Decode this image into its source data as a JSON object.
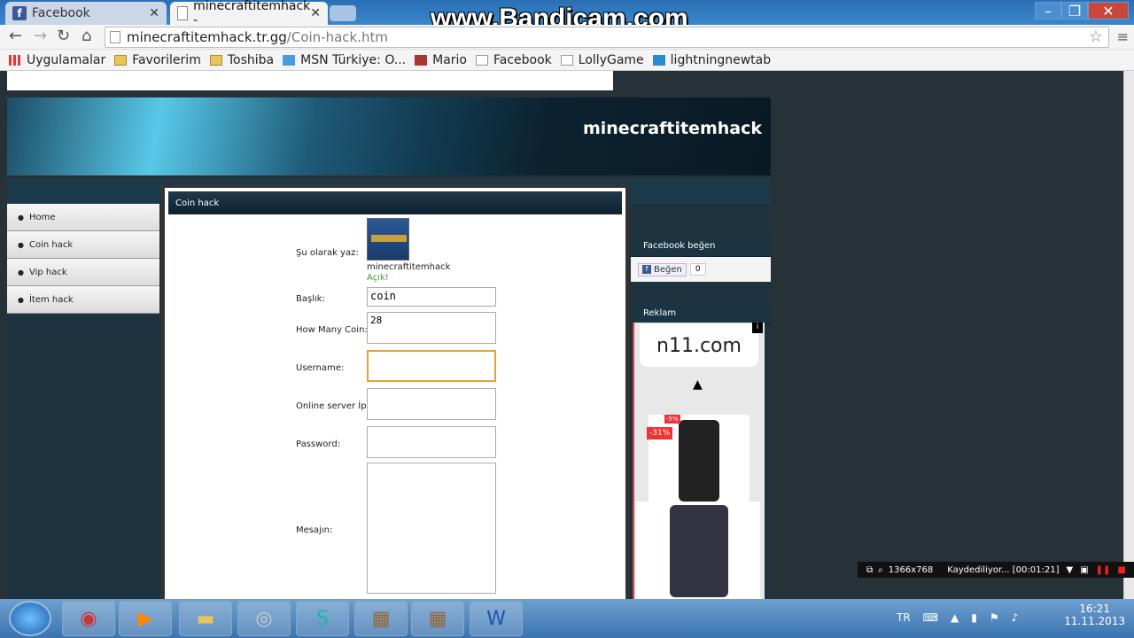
{
  "tabs": [
    {
      "label": "Facebook",
      "active": false,
      "favicon": "facebook-icon"
    },
    {
      "label": "minecraftitemhack -",
      "active": true,
      "favicon": "page-icon"
    }
  ],
  "watermark": "www.Bandicam.com",
  "address": {
    "host": "minecraftitemhack.tr.gg",
    "path": "/Coin-hack.htm"
  },
  "bookmarks": [
    {
      "label": "Uygulamalar",
      "icon": "apps-grid-icon"
    },
    {
      "label": "Favorilerim",
      "icon": "folder-icon"
    },
    {
      "label": "Toshiba",
      "icon": "folder-icon"
    },
    {
      "label": "MSN Türkiye: O...",
      "icon": "msn-icon"
    },
    {
      "label": "Mario",
      "icon": "mario-icon"
    },
    {
      "label": "Facebook",
      "icon": "page-icon"
    },
    {
      "label": "LollyGame",
      "icon": "page-icon"
    },
    {
      "label": "lightningnewtab",
      "icon": "lightning-icon"
    }
  ],
  "site": {
    "title": "minecraftitemhack",
    "nav": [
      "Home",
      "Coin hack",
      "Vip hack",
      "İtem hack"
    ],
    "panel_title": "Coin hack",
    "form": {
      "write_as_label": "Şu olarak yaz:",
      "username_display": "minecraftitemhack",
      "status": "Açık!",
      "title_label": "Başlık:",
      "title_value": "coin",
      "coin_label": "How Many Coin:",
      "coin_value": "28",
      "username_label": "Username:",
      "server_label": "Online server İp:",
      "password_label": "Password:",
      "message_label": "Mesajın:"
    },
    "sidebar": {
      "fb_title": "Facebook beğen",
      "like_label": "Beğen",
      "like_count": "0",
      "ad_title": "Reklam",
      "ad_brand": "n11.com",
      "discount1": "-31%",
      "discount2": "-5%"
    }
  },
  "recorder": {
    "resolution": "1366x768",
    "status": "Kaydediliyor... [00:01:21]"
  },
  "tray": {
    "lang": "TR",
    "time": "16:21",
    "date": "11.11.2013"
  }
}
